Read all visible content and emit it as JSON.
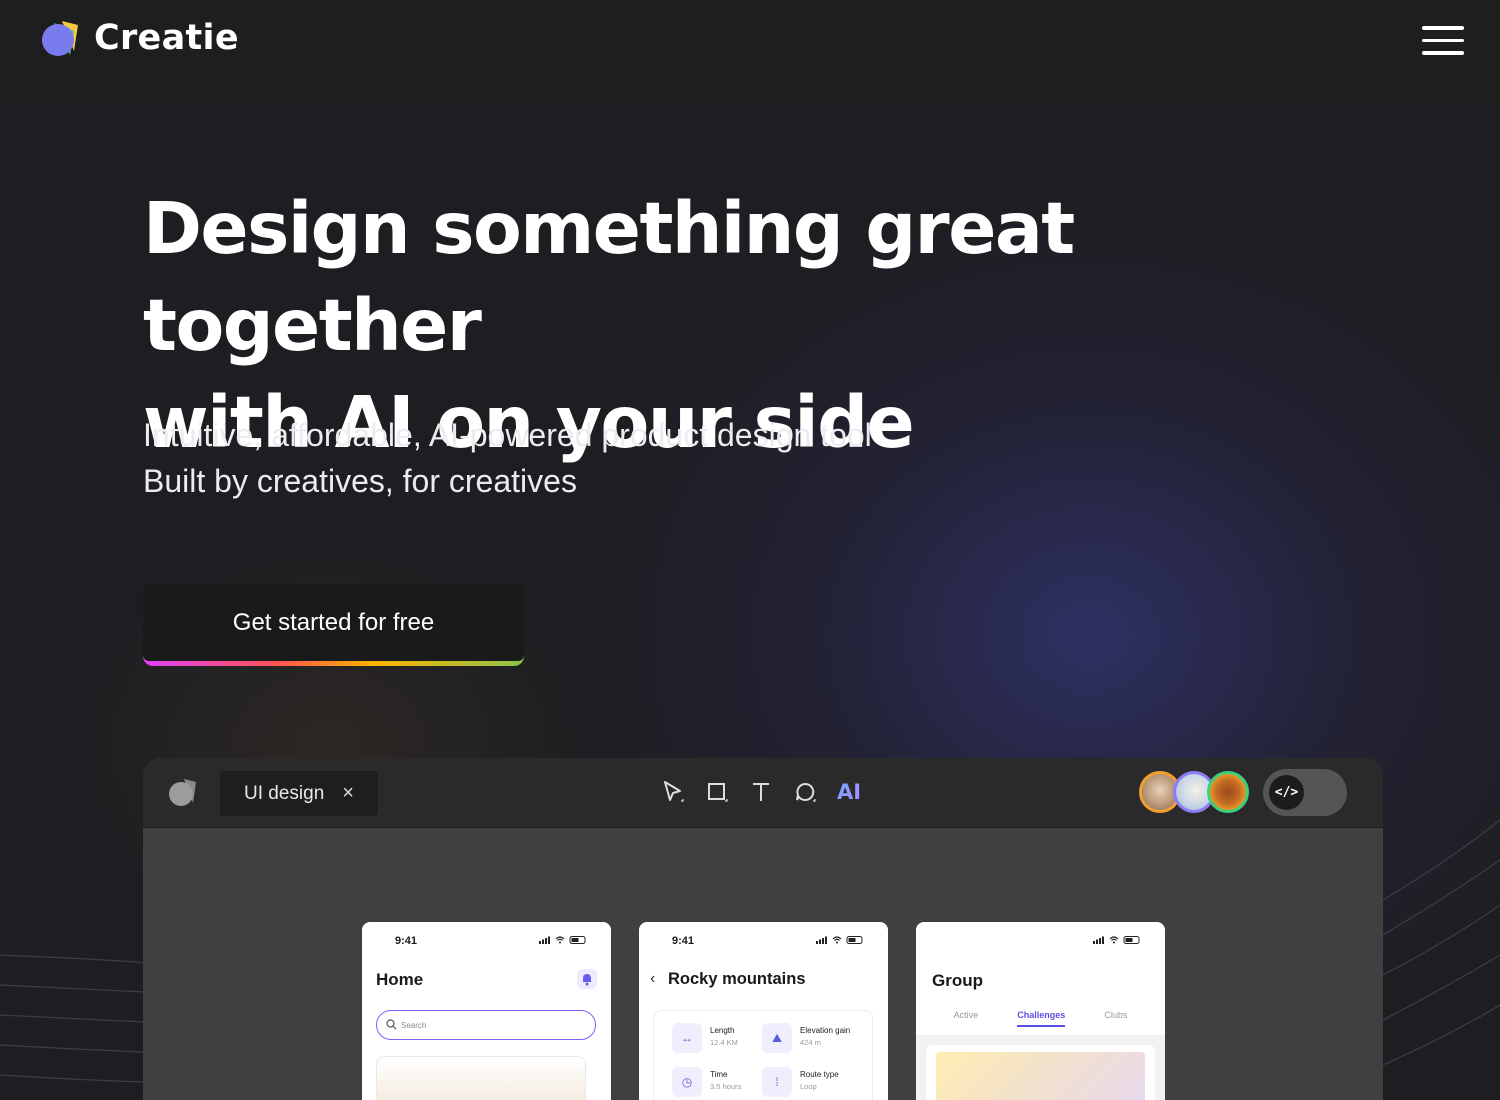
{
  "brand": {
    "name": "Creatie"
  },
  "hero": {
    "title_line1": "Design something great together",
    "title_line2": "with AI on your side",
    "subtitle_line1": "Intuitive, affordable, AI-powered product design tool",
    "subtitle_line2": "Built by creatives, for creatives",
    "cta_label": "Get started for free"
  },
  "editor": {
    "tab_label": "UI design",
    "tab_close": "×",
    "tools": [
      "pointer-tool",
      "frame-tool",
      "text-tool",
      "comment-tool",
      "ai-tool"
    ],
    "ai_label": "AI",
    "dev_mode_symbol": "</>",
    "collaborator_count": 3
  },
  "screens": {
    "home": {
      "time": "9:41",
      "title": "Home",
      "search_placeholder": "Search"
    },
    "trail": {
      "time": "9:41",
      "title": "Rocky mountains",
      "stats": [
        {
          "label": "Length",
          "value": "12.4 KM"
        },
        {
          "label": "Elevation gain",
          "value": "424 m"
        },
        {
          "label": "Time",
          "value": "3.5 hours"
        },
        {
          "label": "Route type",
          "value": "Loop"
        }
      ]
    },
    "group": {
      "title": "Group",
      "tabs": [
        "Active",
        "Challenges",
        "Clubs"
      ],
      "active_tab": "Challenges"
    }
  },
  "colors": {
    "background": "#1e1e20",
    "accent_purple": "#7b61ff",
    "cta_gradient": [
      "#e040fb",
      "#ff5252",
      "#ffb300",
      "#8bc34a"
    ]
  }
}
